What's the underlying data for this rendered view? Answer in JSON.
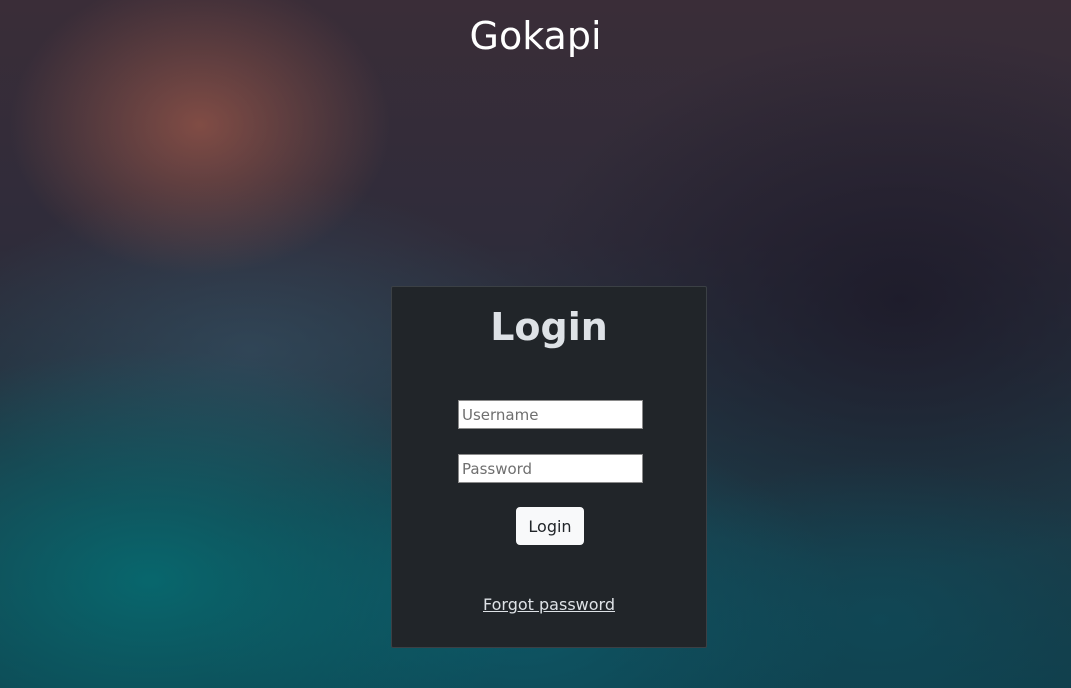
{
  "app": {
    "title": "Gokapi"
  },
  "login": {
    "heading": "Login",
    "username_placeholder": "Username",
    "password_placeholder": "Password",
    "submit_label": "Login",
    "forgot_password_label": "Forgot password"
  },
  "colors": {
    "card_background": "#212529",
    "card_text": "#dee2e6",
    "button_background": "#f8f9fa",
    "title_text": "#ffffff"
  }
}
